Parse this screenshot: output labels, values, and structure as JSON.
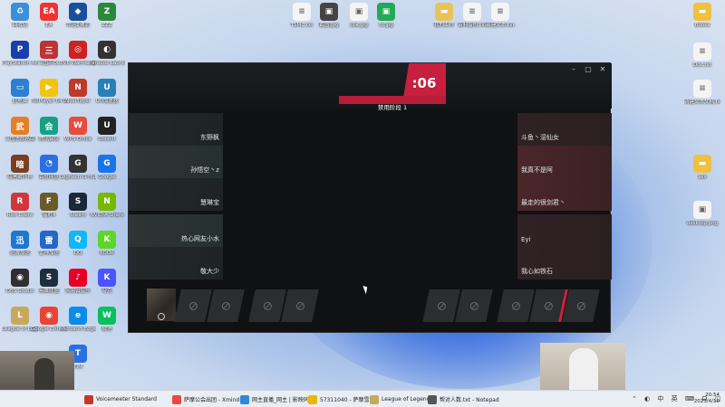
{
  "desktop_icons": [
    {
      "label": "回收站",
      "color": "#3a8fd8",
      "glyph": "♻"
    },
    {
      "label": "EA",
      "color": "#e33",
      "glyph": "EA"
    },
    {
      "label": "命运2辅助",
      "color": "#1a4f9c",
      "glyph": "◆"
    },
    {
      "label": "ZZZ",
      "color": "#2a8a3a",
      "glyph": "Z"
    },
    {
      "label": "PlayStation Accessories",
      "color": "#1b3fa8",
      "glyph": "P"
    },
    {
      "label": "三国杀OL",
      "color": "#b33",
      "glyph": "三"
    },
    {
      "label": "EVE Warframe",
      "color": "#c22",
      "glyph": "◎"
    },
    {
      "label": "Paradox Launcher v2",
      "color": "#333",
      "glyph": "◐"
    },
    {
      "label": "此电脑",
      "color": "#2e7fd2",
      "glyph": "▭"
    },
    {
      "label": "PotPlayer 64 bit",
      "color": "#f1c40f",
      "glyph": "▶"
    },
    {
      "label": "NoxPlayer",
      "color": "#c0392b",
      "glyph": "N"
    },
    {
      "label": "UU加速器",
      "color": "#2980b9",
      "glyph": "U"
    },
    {
      "label": "三国志战略版",
      "color": "#e67e22",
      "glyph": "武"
    },
    {
      "label": "腾讯会议",
      "color": "#16a085",
      "glyph": "会"
    },
    {
      "label": "WPS Office",
      "color": "#e74c3c",
      "glyph": "W"
    },
    {
      "label": "Ubisoft",
      "color": "#222",
      "glyph": "U"
    },
    {
      "label": "暗黑破坏神",
      "color": "#7a3f1f",
      "glyph": "暗"
    },
    {
      "label": "百度网盘",
      "color": "#2b6fe0",
      "glyph": "◔"
    },
    {
      "label": "Logitech G Hub",
      "color": "#333",
      "glyph": "G"
    },
    {
      "label": "Google",
      "color": "#1a73e8",
      "glyph": "G"
    },
    {
      "label": "Riot Client",
      "color": "#d13639",
      "glyph": "R"
    },
    {
      "label": "辐射4",
      "color": "#6b5a2a",
      "glyph": "F"
    },
    {
      "label": "Steam",
      "color": "#1b2838",
      "glyph": "S"
    },
    {
      "label": "NVIDIA Share",
      "color": "#76b900",
      "glyph": "N"
    },
    {
      "label": "迅游加速",
      "color": "#1f77d0",
      "glyph": "迅"
    },
    {
      "label": "雷神加速",
      "color": "#2467c9",
      "glyph": "雷"
    },
    {
      "label": "QQ",
      "color": "#12b7f5",
      "glyph": "Q"
    },
    {
      "label": "KOOK",
      "color": "#5dd62c",
      "glyph": "K"
    },
    {
      "label": "OBS Studio",
      "color": "#302e31",
      "glyph": "◉"
    },
    {
      "label": "英雄联盟",
      "color": "#1d2e3d",
      "glyph": "S"
    },
    {
      "label": "网易云音乐",
      "color": "#e60026",
      "glyph": "♪"
    },
    {
      "label": "夸克",
      "color": "#4a55ff",
      "glyph": "K"
    },
    {
      "label": "League of Legends",
      "color": "#c8a85a",
      "glyph": "L"
    },
    {
      "label": "Google Chrome",
      "color": "#ea4335",
      "glyph": "◉"
    },
    {
      "label": "Microsoft Edge",
      "color": "#0c8ce9",
      "glyph": "e"
    },
    {
      "label": "微信",
      "color": "#07c160",
      "glyph": "W"
    },
    {
      "label": "TIM",
      "color": "#2a6fe3",
      "glyph": "T"
    }
  ],
  "top_files": [
    {
      "label": "TSMC.txt",
      "color": "#f4f4f4",
      "glyph": "≡"
    },
    {
      "label": "截图.jpg",
      "color": "#444",
      "glyph": "▣"
    },
    {
      "label": "cbs.jpg",
      "color": "#f4f4f4",
      "glyph": "▣"
    },
    {
      "label": "fb.jpg",
      "color": "#2a5",
      "glyph": "▣"
    },
    {
      "label": "我的工作",
      "color": "#e8c25a",
      "glyph": "▬"
    },
    {
      "label": "资料备份.txt",
      "color": "#f4f4f4",
      "glyph": "≡"
    },
    {
      "label": "新建文本.txt",
      "color": "#f4f4f4",
      "glyph": "≡"
    }
  ],
  "right_icons": [
    {
      "label": "Books",
      "color": "#f0c040",
      "glyph": "▬"
    },
    {
      "label": "Doc.txt",
      "color": "#f4f4f4",
      "glyph": "≡"
    },
    {
      "label": "新建文本文档.txt",
      "color": "#f4f4f4",
      "glyph": "≡"
    },
    {
      "label": "wls",
      "color": "#f0c040",
      "glyph": "▬"
    },
    {
      "label": "desktop.png",
      "color": "#f4f4f4",
      "glyph": "▣"
    }
  ],
  "client": {
    "timer": ":06",
    "phase": "禁用阶段 1",
    "controls": {
      "minimize": "–",
      "maximize": "▢",
      "close": "✕"
    },
    "blue_team": [
      "东野枫",
      "孙悟空丶z",
      "慧琳宝",
      "热心网友小水",
      "敬大少"
    ],
    "red_team": [
      "斗鱼丶湿仙女",
      "我真不是阿",
      "最走的很剑君丶",
      "Eyi",
      "我心如铁石"
    ]
  },
  "taskbar": {
    "items": [
      {
        "label": "Voicemeeter Standard",
        "color": "#c0392b"
      },
      {
        "label": "萨摩公会出团 - Xmind",
        "color": "#e74c3c"
      },
      {
        "label": "网主直播_网主 | 影映同",
        "color": "#2c8ad8"
      },
      {
        "label": "57311040 - 萨摩雪号",
        "color": "#e6b800"
      },
      {
        "label": "League of Legends",
        "color": "#c8a85a"
      },
      {
        "label": "帮对人数.txt - Notepad",
        "color": "#555"
      }
    ],
    "tray_icons": "⌃ ◐ 中 英 ⌨ ☊ ◫",
    "time": "20:54",
    "date": "2025/4/10"
  }
}
